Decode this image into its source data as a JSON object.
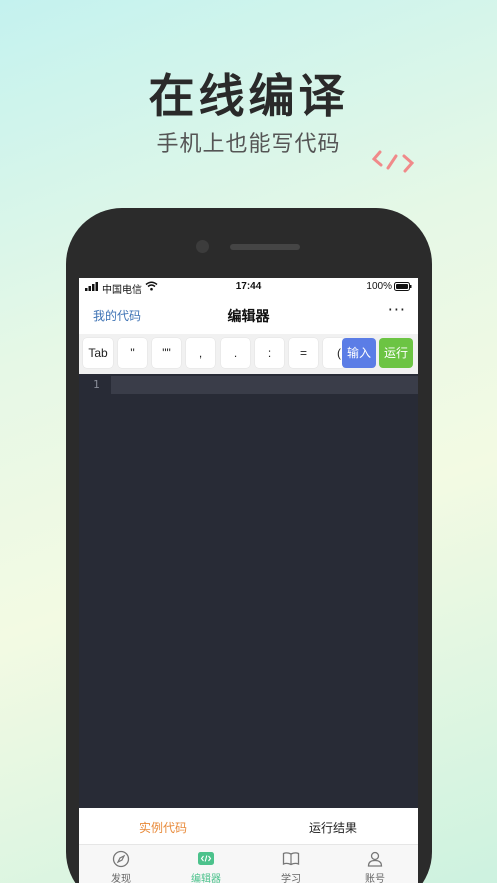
{
  "promo": {
    "headline": "在线编译",
    "subline": "手机上也能写代码"
  },
  "statusbar": {
    "carrier": "中国电信",
    "time": "17:44",
    "battery": "100%"
  },
  "navbar": {
    "back": "我的代码",
    "title": "编辑器",
    "more": "···"
  },
  "keybar": {
    "keys": [
      "Tab",
      "''",
      "\"\"",
      ",",
      ".",
      ":",
      "=",
      "("
    ],
    "input_label": "输入",
    "run_label": "运行"
  },
  "editor": {
    "line_number": "1"
  },
  "bottom_tabs": {
    "examples": "实例代码",
    "results": "运行结果"
  },
  "tabbar": {
    "discover": "发现",
    "editor": "编辑器",
    "learn": "学习",
    "account": "账号"
  },
  "colors": {
    "accent_green": "#4cc28c",
    "examples_orange": "#e88a3a",
    "input_blue": "#5b7de6",
    "run_green": "#6cc443",
    "editor_bg": "#282b36"
  }
}
